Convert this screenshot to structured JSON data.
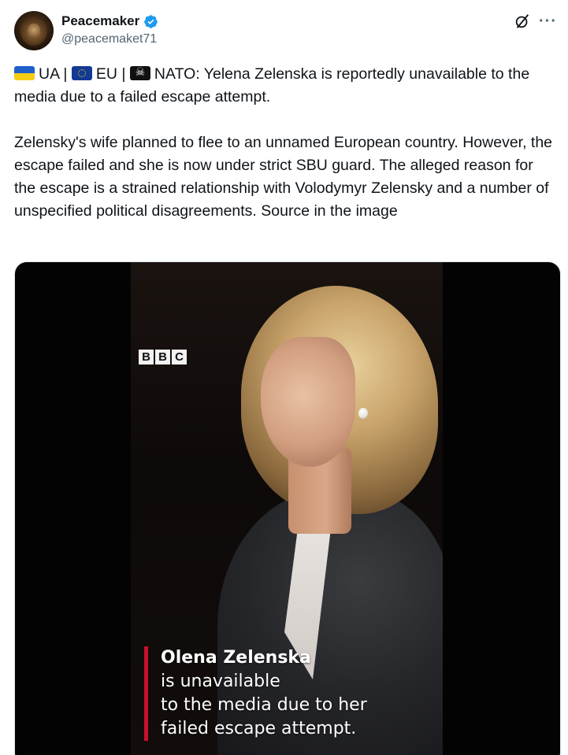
{
  "author": {
    "display_name": "Peacemaker",
    "handle": "@peacemaket71",
    "verified": true,
    "avatar_icon": "lion-avatar"
  },
  "header_actions": {
    "grok_icon": "grok-icon",
    "more_label": "···"
  },
  "tweet": {
    "paragraph1": {
      "flag_ua": "🇺🇦",
      "flag_eu": "🇪🇺",
      "flag_pirate": "🏴‍☠️",
      "seg1": "UA | ",
      "seg2": "EU | ",
      "seg3": "NATO: Yelena Zelenska is reportedly unavailable to the media due to a failed escape attempt."
    },
    "paragraph2": "Zelensky's wife planned to flee to an unnamed European country. However, the escape failed and she is now under strict SBU guard. The alleged reason for the escape is a strained relationship with Volodymyr Zelensky and a number of unspecified political disagreements. Source in the image"
  },
  "media": {
    "logo_letters": [
      "B",
      "B",
      "C"
    ],
    "caption_lines": [
      "Olena Zelenska",
      "is unavailable",
      "to the media due to her",
      "failed escape attempt."
    ],
    "caption_bar_color": "#c8102e"
  },
  "colors": {
    "verified_blue": "#1d9bf0",
    "handle_gray": "#536471",
    "text": "#0f1419"
  }
}
